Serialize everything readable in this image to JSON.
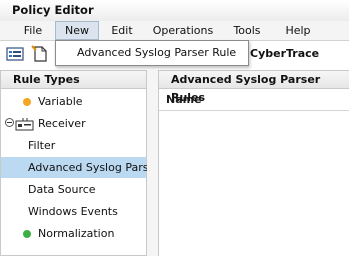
{
  "window": {
    "title": "Policy Editor"
  },
  "menubar": {
    "items": [
      "File",
      "New",
      "Edit",
      "Operations",
      "Tools",
      "Help"
    ]
  },
  "new_menu": {
    "items": [
      "Advanced Syslog Parser Rule"
    ]
  },
  "toolbar": {
    "brand": "CyberTrace",
    "icons": [
      "policy-list-icon",
      "new-document-icon"
    ]
  },
  "rule_types": {
    "title": "Rule Types",
    "items": [
      {
        "label": "Variable",
        "icon": "orange-dot",
        "color": "#f5a623"
      },
      {
        "label": "Receiver",
        "icon": "receiver-icon"
      },
      {
        "label": "Filter"
      },
      {
        "label": "Advanced Syslog Parse",
        "selected": true
      },
      {
        "label": "Data Source"
      },
      {
        "label": "Windows Events"
      },
      {
        "label": "Normalization",
        "icon": "green-dot",
        "color": "#3cb043"
      }
    ]
  },
  "rules_panel": {
    "title": "Advanced Syslog Parser Rules",
    "columns": [
      "Name"
    ]
  },
  "colors": {
    "selection": "#bcd9f2",
    "menu_active": "#dbe4ee"
  }
}
